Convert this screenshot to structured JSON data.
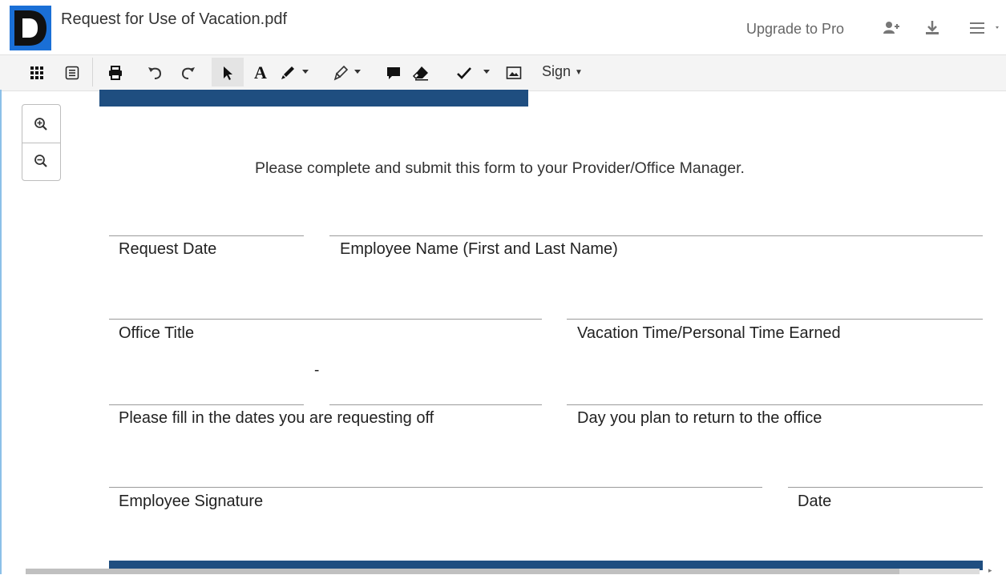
{
  "header": {
    "doc_title": "Request for Use of Vacation.pdf",
    "upgrade_label": "Upgrade to Pro",
    "icons": [
      "logo-icon",
      "add-user-icon",
      "download-icon",
      "hamburger-menu-icon"
    ]
  },
  "toolbar": {
    "sign_label": "Sign",
    "text_tool_glyph": "A",
    "icons": [
      "thumbnails-grid-icon",
      "outline-list-icon",
      "print-icon",
      "undo-icon",
      "redo-icon",
      "select-arrow-icon",
      "text-tool-icon",
      "pen-icon",
      "highlighter-icon",
      "comment-icon",
      "eraser-icon",
      "checkmark-icon",
      "image-icon"
    ]
  },
  "zoom": {
    "icons": [
      "zoom-in-icon",
      "zoom-out-icon"
    ]
  },
  "document": {
    "instructions": "Please complete and submit this form to your Provider/Office Manager.",
    "fields": {
      "request_date": "Request Date",
      "employee_name": "Employee Name (First and Last Name)",
      "office_title": "Office Title",
      "vacation_time": "Vacation Time/Personal Time Earned",
      "dates_off": "Please fill in the dates you are requesting off",
      "return_day": "Day you plan to return to the office",
      "employee_signature": "Employee Signature",
      "date": "Date"
    },
    "dash": "-"
  },
  "colors": {
    "band": "#1f4e80",
    "toolbar_bg": "#f4f4f4"
  }
}
